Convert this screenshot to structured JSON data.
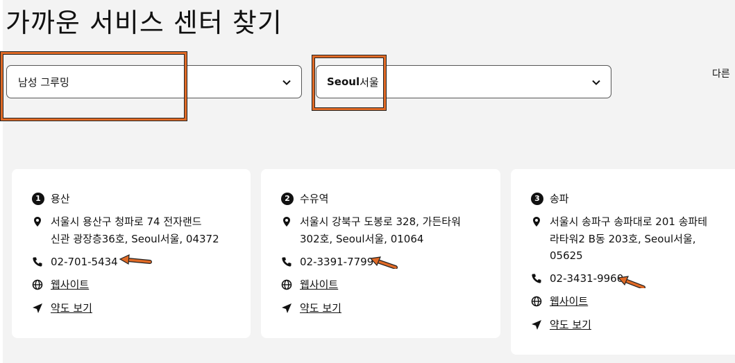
{
  "page": {
    "title": "가까운 서비스 센터 찾기"
  },
  "filters": {
    "product": {
      "value": "남성 그루밍"
    },
    "city": {
      "value_en": "Seoul",
      "value_ko": "서울"
    },
    "other_label": "다른"
  },
  "centers": [
    {
      "index": "1",
      "name": "용산",
      "address": "서울시 용산구 청파로 74 전자랜드\n신관 광장층36호, Seoul서울, 04372",
      "phone": "02-701-5434",
      "website": "웹사이트",
      "map": "약도 보기"
    },
    {
      "index": "2",
      "name": "수유역",
      "address": "서울시 강북구 도봉로 328, 가든타워\n302호, Seoul서울, 01064",
      "phone": "02-3391-7799",
      "website": "웹사이트",
      "map": "약도 보기"
    },
    {
      "index": "3",
      "name": "송파",
      "address": "서울시 송파구 송파대로 201 송파테\n라타워2 B동 203호, Seoul서울,\n05625",
      "phone": "02-3431-9960",
      "website": "웹사이트",
      "map": "약도 보기"
    }
  ],
  "annotation_color": "#e06a26"
}
